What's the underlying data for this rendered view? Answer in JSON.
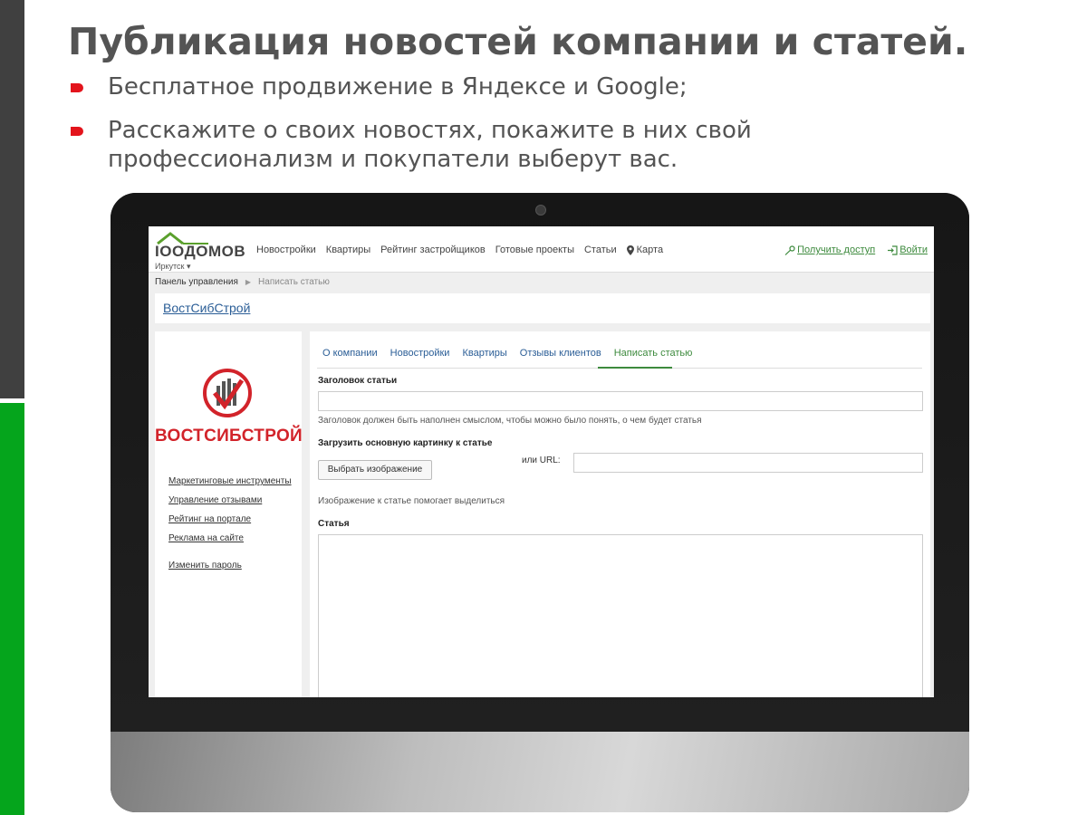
{
  "slide": {
    "title": "Публикация новостей компании и статей.",
    "bullets": [
      "Бесплатное продвижение в Яндексе и Google;",
      "Расскажите о своих новостях, покажите в них свой профессионализм и покупатели выберут вас."
    ]
  },
  "site": {
    "logo": "IOOДОМОВ",
    "city": "Иркутск ▾",
    "nav": [
      "Новостройки",
      "Квартиры",
      "Рейтинг застройщиков",
      "Готовые проекты",
      "Статьи",
      "Карта"
    ],
    "get_access": "Получить доступ",
    "login": "Войти",
    "breadcrumb": [
      "Панель управления",
      "Написать статью"
    ],
    "company_link": "ВостСибСтрой",
    "brand_name": "ВОСТСИБСТРОЙ",
    "sidebar_links": [
      "Маркетинговые инструменты",
      "Управление отзывами",
      "Рейтинг на портале",
      "Реклама на сайте",
      "Изменить пароль"
    ],
    "tabs": [
      "О компании",
      "Новостройки",
      "Квартиры",
      "Отзывы клиентов",
      "Написать статью"
    ],
    "form": {
      "title_label": "Заголовок статьи",
      "title_hint": "Заголовок должен быть наполнен смыслом, чтобы можно было понять, о чем будет статья",
      "image_label": "Загрузить основную картинку к статье",
      "choose_image": "Выбрать изображение",
      "url_label": "или URL:",
      "image_hint": "Изображение к статье помогает выделиться",
      "article_label": "Статья"
    }
  },
  "colors": {
    "accent_green": "#3d8a3d",
    "link_blue": "#2a5d96",
    "brand_red": "#d2232a",
    "bullet_red": "#e3141c",
    "side_green": "#05a51c"
  }
}
